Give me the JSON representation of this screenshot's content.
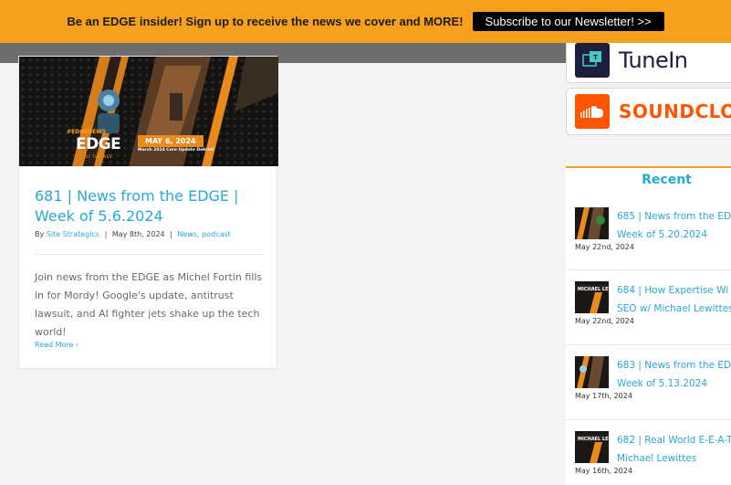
{
  "topbar": {
    "text": "Be an EDGE insider! Sign up to receive the news we cover and MORE!",
    "button_label": "Subscribe to our Newsletter! >>"
  },
  "post": {
    "thumbnail": {
      "hashtag": "#EDGENEWS",
      "logo": "EDGE",
      "logo_sub": "OF THE WEB",
      "date_badge": "MAY 6, 2024",
      "caption": "March 2024 Core Update Debrief"
    },
    "title_line1": "681 | News from the EDGE |",
    "title_line2": "Week of 5.6.2024",
    "meta": {
      "by": "By",
      "author": "Site Strategics",
      "sep1": "|",
      "date": "May 8th, 2024",
      "sep2": "|",
      "categories": "News, podcast"
    },
    "excerpt": "Join news from the EDGE as Michel Fortin fills in for Mordy! Google's update, antitrust lawsuit, and AI fighter jets shake up the tech world!",
    "read_more": "Read More ›"
  },
  "sidebar": {
    "platforms": [
      {
        "name": "TuneIn",
        "icon": "tunein-icon",
        "color": "#1c203c"
      },
      {
        "name": "SOUNDCLOU",
        "icon": "soundcloud-icon",
        "color": "#ff5500"
      }
    ],
    "recent": {
      "title": "Recent",
      "items": [
        {
          "line1": "685 | News from the ED",
          "line2": "Week of 5.20.2024",
          "date": "May 22nd, 2024"
        },
        {
          "line1": "684 | How Expertise Wi",
          "line2": "SEO w/ Michael Lewittes",
          "date": "May 22nd, 2024"
        },
        {
          "line1": "683 | News from the ED",
          "line2": "Week of 5.13.2024",
          "date": "May 17th, 2024"
        },
        {
          "line1": "682 | Real World E-E-A-T",
          "line2": "Michael Lewittes",
          "date": "May 16th, 2024"
        }
      ]
    }
  },
  "colors": {
    "accent_orange": "#f7a01e",
    "link_blue": "#27a9d6",
    "soundcloud_orange": "#ff5500",
    "tunein_navy": "#1c203c"
  }
}
